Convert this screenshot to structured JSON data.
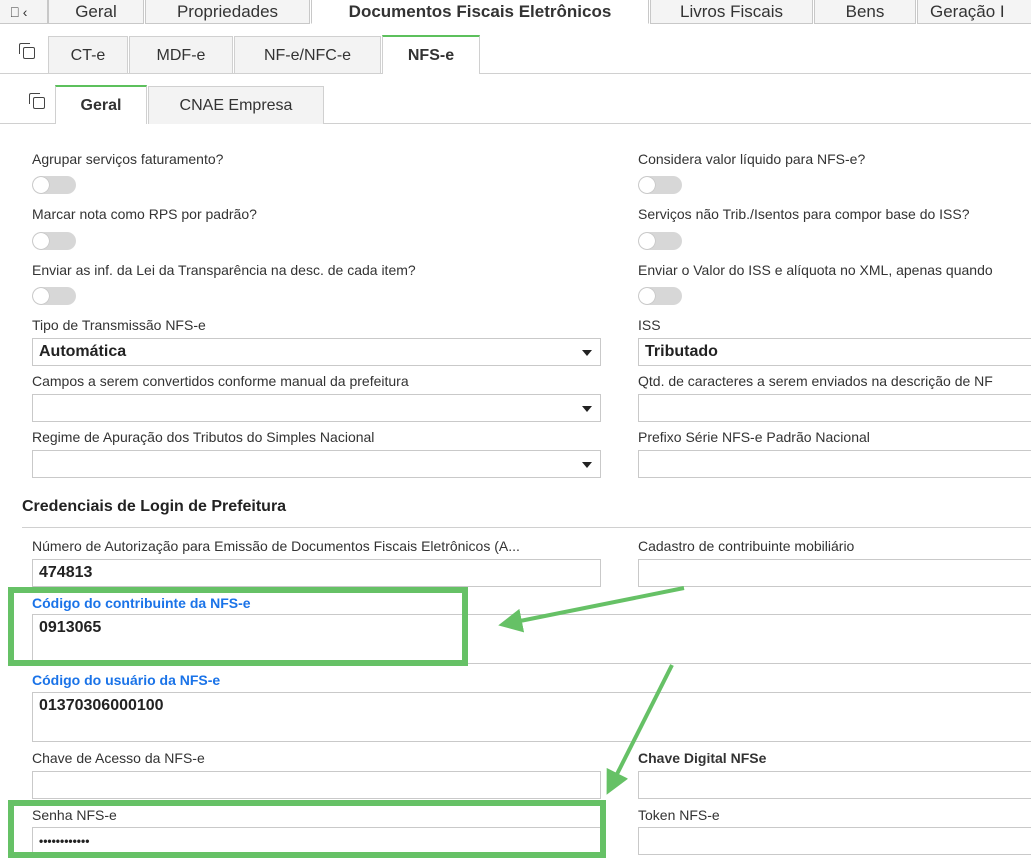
{
  "top_tabs": [
    {
      "label": "Geral"
    },
    {
      "label": "Propriedades"
    },
    {
      "label": "Documentos Fiscais Eletrônicos"
    },
    {
      "label": "Livros Fiscais"
    },
    {
      "label": "Bens"
    },
    {
      "label": "Geração I"
    }
  ],
  "doc_tabs": [
    "CT-e",
    "MDF-e",
    "NF-e/NFC-e",
    "NFS-e"
  ],
  "sub_tabs": [
    "Geral",
    "CNAE Empresa"
  ],
  "toggles": {
    "agrupar": "Agrupar serviços faturamento?",
    "marcar_rps": "Marcar nota como RPS por padrão?",
    "lei_transparencia": "Enviar as inf. da Lei da Transparência na desc. de cada item?",
    "valor_liquido": "Considera valor líquido para NFS-e?",
    "nao_trib": "Serviços não Trib./Isentos para compor base do ISS?",
    "valor_iss": "Enviar o Valor do ISS e alíquota no XML, apenas quando"
  },
  "fields": {
    "tipo_transmissao": {
      "label": "Tipo de Transmissão NFS-e",
      "value": "Automática"
    },
    "iss": {
      "label": "ISS",
      "value": "Tributado"
    },
    "campos_convertidos": {
      "label": "Campos a serem convertidos conforme manual da prefeitura",
      "value": ""
    },
    "qtd_caracteres": {
      "label": "Qtd. de caracteres a serem enviados na descrição de NF",
      "value": ""
    },
    "regime_apuracao": {
      "label": "Regime de Apuração dos Tributos do Simples Nacional",
      "value": ""
    },
    "prefixo_serie": {
      "label": "Prefixo Série NFS-e Padrão Nacional",
      "value": ""
    }
  },
  "section_title": "Credenciais de Login de Prefeitura",
  "credentials": {
    "num_autorizacao": {
      "label": "Número de Autorização para Emissão de Documentos Fiscais Eletrônicos (A...",
      "value": "474813"
    },
    "cadastro_mobiliario": {
      "label": "Cadastro de contribuinte mobiliário",
      "value": ""
    },
    "cod_contribuinte": {
      "label": "Código do contribuinte da NFS-e",
      "value": "0913065"
    },
    "cod_usuario": {
      "label": "Código do usuário da NFS-e",
      "value": "01370306000100"
    },
    "chave_acesso": {
      "label": "Chave de Acesso da NFS-e",
      "value": ""
    },
    "chave_digital": {
      "label": "Chave Digital NFSe",
      "value": ""
    },
    "senha": {
      "label": "Senha NFS-e",
      "value": "••••••••••••"
    },
    "token": {
      "label": "Token NFS-e",
      "value": ""
    }
  },
  "colors": {
    "highlight": "#66c166",
    "accent": "#1a73e8",
    "tab_active_border": "#5cc05c"
  }
}
